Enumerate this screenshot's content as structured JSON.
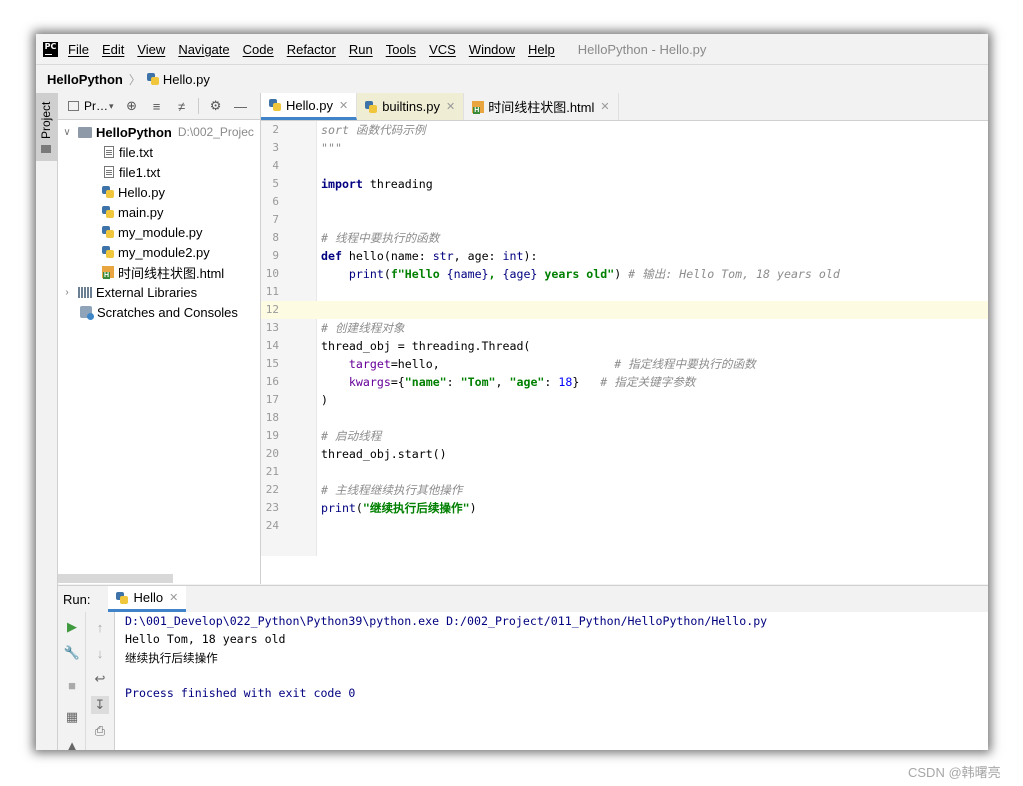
{
  "menubar": {
    "logo": "PC",
    "items": [
      "File",
      "Edit",
      "View",
      "Navigate",
      "Code",
      "Refactor",
      "Run",
      "Tools",
      "VCS",
      "Window",
      "Help"
    ],
    "title": "HelloPython - Hello.py"
  },
  "navbar": {
    "project": "HelloPython",
    "file": "Hello.py"
  },
  "stripe": {
    "label": "Project"
  },
  "project_panel": {
    "toolbar_label": "Pr…",
    "root": {
      "name": "HelloPython",
      "path": "D:\\002_Projec"
    },
    "files": [
      "file.txt",
      "file1.txt",
      "Hello.py",
      "main.py",
      "my_module.py",
      "my_module2.py",
      "时间线柱状图.html"
    ],
    "external": "External Libraries",
    "scratches": "Scratches and Consoles"
  },
  "editor": {
    "tabs": [
      "Hello.py",
      "builtins.py",
      "时间线柱状图.html"
    ],
    "line_numbers": [
      "2",
      "3",
      "4",
      "5",
      "6",
      "7",
      "8",
      "9",
      "10",
      "11",
      "12",
      "13",
      "14",
      "15",
      "16",
      "17",
      "18",
      "19",
      "20",
      "21",
      "22",
      "23",
      "24"
    ],
    "code": {
      "l2": "sort 函数代码示例",
      "l3": "\"\"\"",
      "l5a": "import",
      "l5b": " threading",
      "l8": "# 线程中要执行的函数",
      "l9a": "def",
      "l9b": " hello(name: ",
      "l9c": "str",
      "l9d": ", age: ",
      "l9e": "int",
      "l9f": "):",
      "l10a": "    ",
      "l10b": "print",
      "l10c": "(",
      "l10d": "f\"Hello ",
      "l10e": "{name}",
      "l10f": ", ",
      "l10g": "{age}",
      "l10h": " years old\"",
      "l10i": ")",
      "l10j": " # 输出: Hello Tom, 18 years old",
      "l13": "# 创建线程对象",
      "l14": "thread_obj = threading.Thread(",
      "l15a": "    ",
      "l15b": "target",
      "l15c": "=hello,",
      "l15d": "                         # 指定线程中要执行的函数",
      "l16a": "    ",
      "l16b": "kwargs",
      "l16c": "={",
      "l16d": "\"name\"",
      "l16e": ": ",
      "l16f": "\"Tom\"",
      "l16g": ", ",
      "l16h": "\"age\"",
      "l16i": ": ",
      "l16j": "18",
      "l16k": "}",
      "l16l": "   # 指定关键字参数",
      "l17": ")",
      "l19": "# 启动线程",
      "l20": "thread_obj.start()",
      "l22": "# 主线程继续执行其他操作",
      "l23a": "print",
      "l23b": "(",
      "l23c": "\"继续执行后续操作\"",
      "l23d": ")"
    }
  },
  "run": {
    "label": "Run:",
    "tab": "Hello",
    "output": [
      "D:\\001_Develop\\022_Python\\Python39\\python.exe D:/002_Project/011_Python/HelloPython/Hello.py",
      "Hello Tom, 18 years old",
      "继续执行后续操作",
      "Process finished with exit code 0"
    ]
  },
  "watermark": "CSDN @韩曙亮",
  "colors": {
    "accent": "#4083c9",
    "keyword": "#000080",
    "string": "#008000",
    "comment": "#8c8c8c",
    "number": "#0000ff",
    "current_line": "#fdfbe2"
  }
}
